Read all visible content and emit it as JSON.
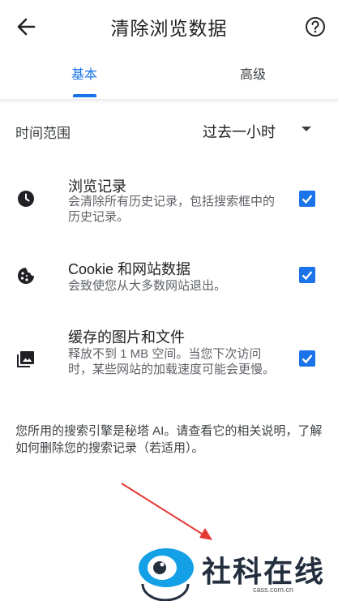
{
  "header": {
    "title": "清除浏览数据",
    "back_icon": "arrow-left-icon",
    "help_icon": "help-circle-icon"
  },
  "tabs": [
    {
      "label": "基本",
      "active": true
    },
    {
      "label": "高级",
      "active": false
    }
  ],
  "time_range": {
    "label": "时间范围",
    "value": "过去一小时"
  },
  "items": [
    {
      "name": "浏览记录",
      "desc": "会清除所有历史记录，包括搜索框中的历史记录。",
      "icon": "clock-icon",
      "checked": true
    },
    {
      "name": "Cookie 和网站数据",
      "desc": "会致使您从大多数网站退出。",
      "icon": "cookie-icon",
      "checked": true
    },
    {
      "name": "缓存的图片和文件",
      "desc": "释放不到 1 MB 空间。当您下次访问时，某些网站的加载速度可能会更慢。",
      "icon": "image-icon",
      "checked": true
    }
  ],
  "footer_note": "您所用的搜索引擎是秘塔 AI。请查看它的相关说明，了解如何删除您的搜索记录（若适用）。",
  "watermark": {
    "text": "社科在线",
    "url": "cass.com.cn"
  },
  "colors": {
    "accent": "#1a73e8",
    "text": "#202124",
    "secondary": "#5f6368"
  }
}
